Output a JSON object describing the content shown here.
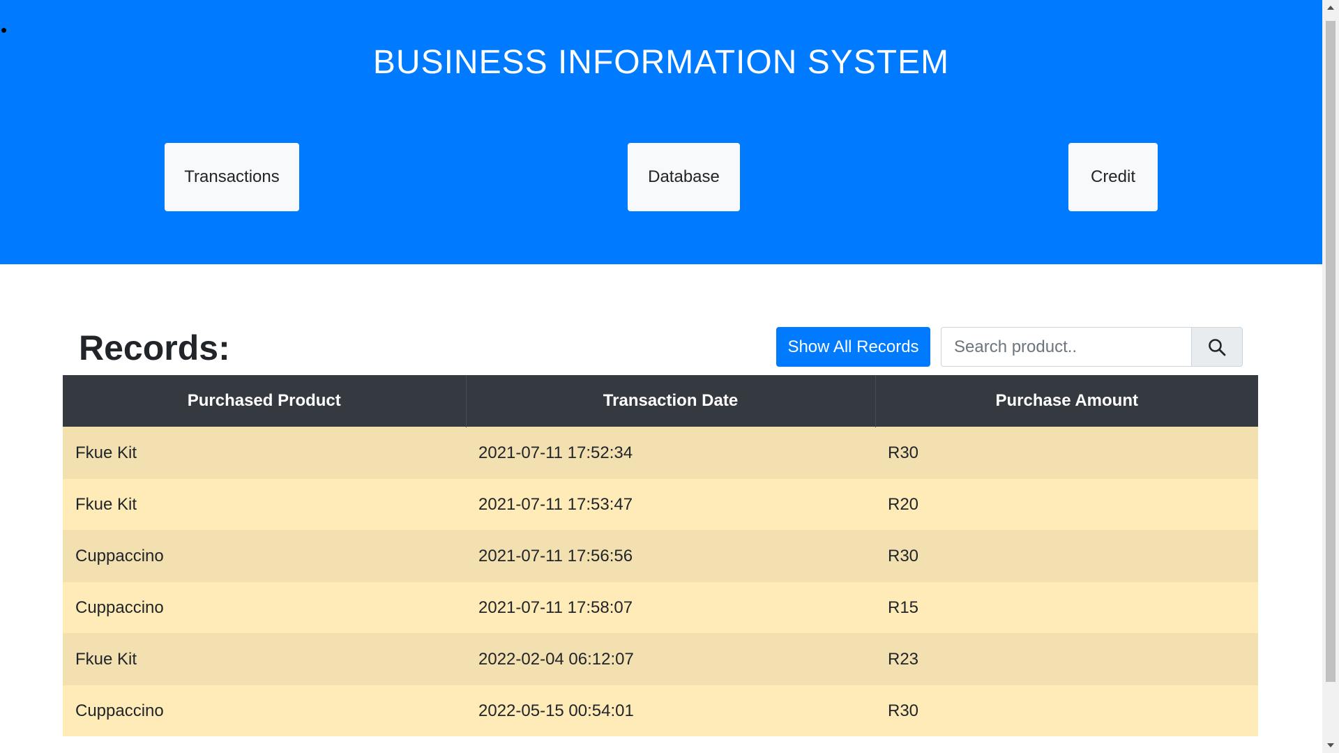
{
  "header": {
    "title": "BUSINESS INFORMATION SYSTEM",
    "background_color": "#007bff",
    "nav": [
      {
        "label": "Transactions"
      },
      {
        "label": "Database"
      },
      {
        "label": "Credit"
      }
    ]
  },
  "records": {
    "title": "Records:",
    "show_all_label": "Show All Records",
    "search": {
      "value": "",
      "placeholder": "Search product..",
      "icon": "search-icon"
    },
    "table": {
      "columns": [
        "Purchased Product",
        "Transaction Date",
        "Purchase Amount"
      ],
      "rows": [
        [
          "Fkue Kit",
          "2021-07-11 17:52:34",
          "R30"
        ],
        [
          "Fkue Kit",
          "2021-07-11 17:53:47",
          "R20"
        ],
        [
          "Cuppaccino",
          "2021-07-11 17:56:56",
          "R30"
        ],
        [
          "Cuppaccino",
          "2021-07-11 17:58:07",
          "R15"
        ],
        [
          "Fkue Kit",
          "2022-02-04 06:12:07",
          "R23"
        ],
        [
          "Cuppaccino",
          "2022-05-15 00:54:01",
          "R30"
        ]
      ],
      "header_color": "#343a40",
      "row_colors": [
        "#f2e0b0",
        "#ffebb7"
      ]
    }
  }
}
